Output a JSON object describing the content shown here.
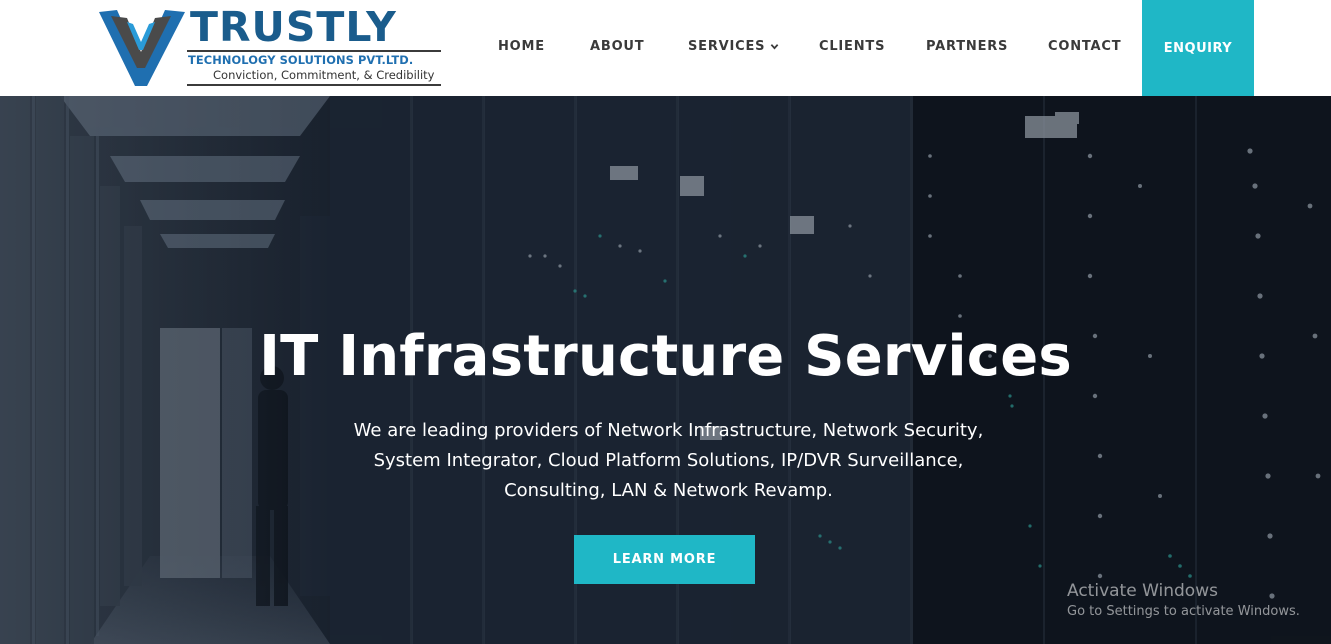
{
  "brand": {
    "name": "TRUSTLY",
    "subtitle": "TECHNOLOGY SOLUTIONS PVT.LTD.",
    "tagline": "Conviction, Commitment, & Credibility",
    "colors": {
      "name": "#1a5c8c",
      "subtitle": "#1f6fb0",
      "accent": "#1fb7c6"
    }
  },
  "nav": {
    "items": [
      {
        "label": "HOME"
      },
      {
        "label": "ABOUT"
      },
      {
        "label": "SERVICES",
        "icon": "chevron-down-icon"
      },
      {
        "label": "CLIENTS"
      },
      {
        "label": "PARTNERS"
      },
      {
        "label": "CONTACT"
      }
    ],
    "cta": "ENQUIRY"
  },
  "hero": {
    "title": "IT Infrastructure Services",
    "description": "We are leading providers of Network Infrastructure, Network Security, System Integrator, Cloud Platform Solutions, IP/DVR Surveillance, Consulting, LAN & Network Revamp.",
    "button": "LEARN MORE"
  },
  "watermark": {
    "title": "Activate Windows",
    "subtitle": "Go to Settings to activate Windows."
  }
}
